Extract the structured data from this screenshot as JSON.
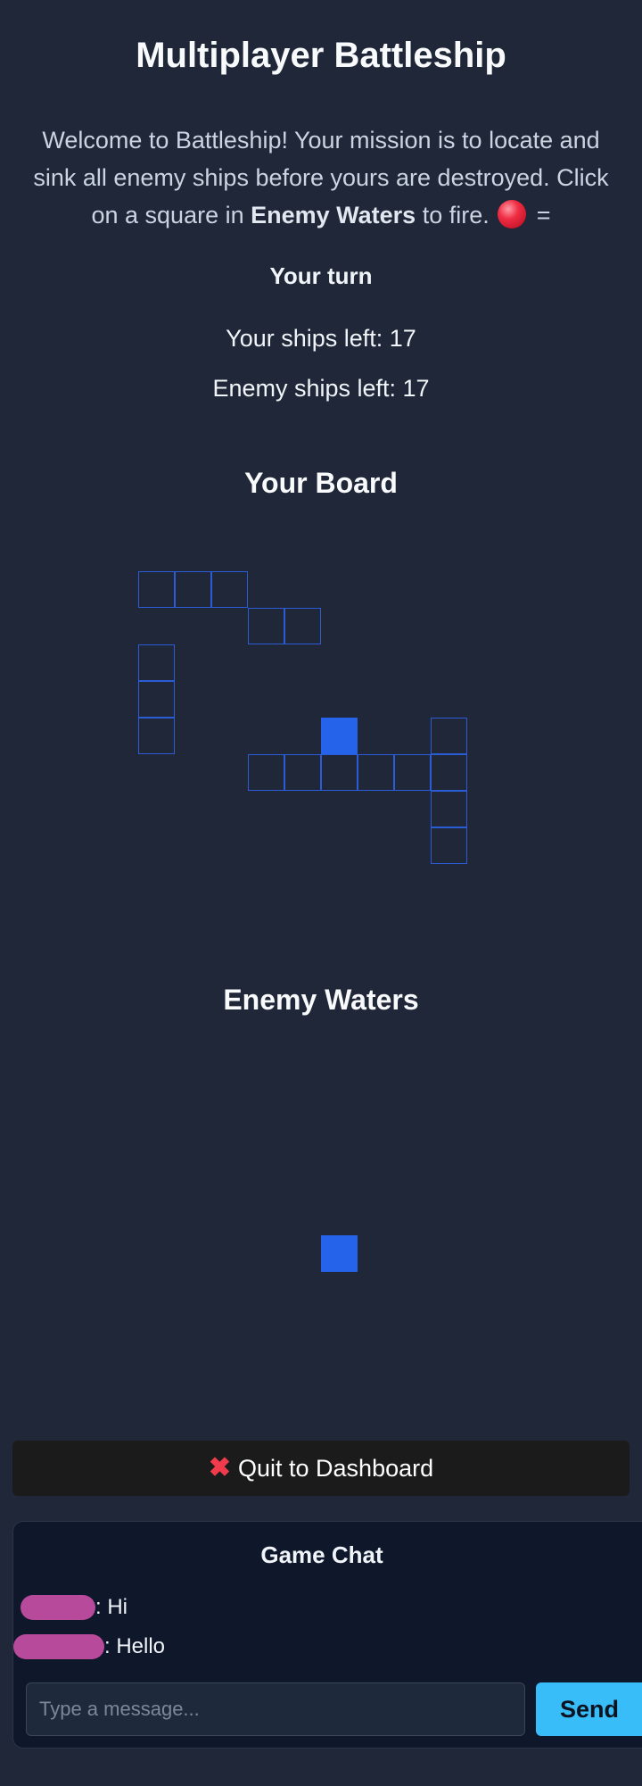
{
  "header": {
    "title": "Multiplayer Battleship",
    "intro_prefix": "Welcome to Battleship! Your mission is to locate and sink all enemy ships before yours are destroyed. Click on a square in ",
    "intro_bold": "Enemy Waters",
    "intro_suffix": " to fire.",
    "intro_after_icon": " ="
  },
  "status": {
    "turn": "Your turn",
    "your_ships": "Your ships left: 17",
    "enemy_ships": "Enemy ships left: 17"
  },
  "your_board": {
    "title": "Your Board",
    "grid_size": 10,
    "ship_cells": [
      [
        0,
        0
      ],
      [
        0,
        1
      ],
      [
        0,
        2
      ],
      [
        1,
        3
      ],
      [
        1,
        4
      ],
      [
        2,
        0
      ],
      [
        3,
        0
      ],
      [
        4,
        0
      ],
      [
        4,
        8
      ],
      [
        5,
        3
      ],
      [
        5,
        4
      ],
      [
        5,
        5
      ],
      [
        5,
        6
      ],
      [
        5,
        7
      ],
      [
        5,
        8
      ],
      [
        6,
        8
      ],
      [
        7,
        8
      ]
    ],
    "filled_cells": [
      [
        4,
        5
      ]
    ]
  },
  "enemy_board": {
    "title": "Enemy Waters",
    "grid_size": 10,
    "filled_cells": [
      [
        5,
        5
      ]
    ]
  },
  "actions": {
    "quit_label": "Quit to Dashboard",
    "quit_icon": "cross-mark-icon"
  },
  "chat": {
    "title": "Game Chat",
    "messages": [
      {
        "text": ": Hi"
      },
      {
        "text": ": Hello"
      }
    ],
    "input_placeholder": "Type a message...",
    "send_label": "Send"
  },
  "colors": {
    "background": "#1f2738",
    "ship_outline": "#2a5cd6",
    "cell_fill": "#2563eb",
    "send_button": "#38bdf8",
    "hit_marker": "#ef2d43"
  }
}
